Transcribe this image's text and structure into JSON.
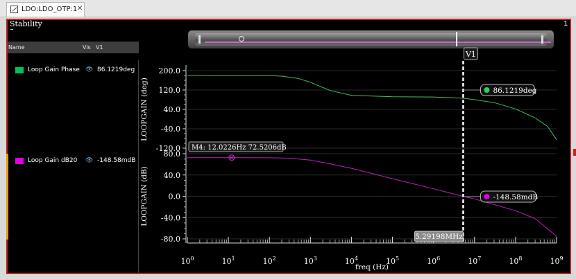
{
  "tab": {
    "label": "LDO:LDO_OTP:1",
    "close": "✕"
  },
  "panel": {
    "title": "Stability",
    "number": "1"
  },
  "legend": {
    "headers": {
      "name": "Name",
      "vis": "Vis",
      "v1": "V1"
    },
    "rows": [
      {
        "name": "Loop Gain Phase",
        "value": "86.1219deg",
        "color": "#00c060"
      },
      {
        "name": "Loop Gain dB20",
        "value": "-148.58mdB",
        "color": "#e000e0"
      }
    ]
  },
  "cursor": {
    "name": "V1",
    "label": "5.29198MHz",
    "freq_hz": 5291980
  },
  "marker": {
    "label": "M4: 12.0226Hz 72.5206dB",
    "freq_hz": 12.0226,
    "value_db": 72.5206
  },
  "chart_data": {
    "type": "line",
    "xlabel": "freq (Hz)",
    "x_scale": "log",
    "xlim": [
      1,
      1000000000
    ],
    "x_ticks": [
      {
        "base": "10",
        "exp": "0"
      },
      {
        "base": "10",
        "exp": "1"
      },
      {
        "base": "10",
        "exp": "2"
      },
      {
        "base": "10",
        "exp": "3"
      },
      {
        "base": "10",
        "exp": "4"
      },
      {
        "base": "10",
        "exp": "5"
      },
      {
        "base": "10",
        "exp": "6"
      },
      {
        "base": "10",
        "exp": "7"
      },
      {
        "base": "10",
        "exp": "8"
      },
      {
        "base": "10",
        "exp": "9"
      }
    ],
    "panels": [
      {
        "ylabel": "LOOPGAIN (deg)",
        "ylim": [
          -120,
          200
        ],
        "y_ticks": [
          "200.0",
          "120.0",
          "40.0",
          "-40.0",
          "-120.0"
        ],
        "y_tick_values": [
          200,
          120,
          40,
          -40,
          -120
        ],
        "series": [
          {
            "name": "Loop Gain Phase",
            "color": "#3fc060",
            "x": [
              1,
              100,
              200,
              500,
              1000,
              3000,
              10000,
              100000,
              1000000,
              5291980,
              10000000,
              30000000,
              100000000,
              300000000,
              600000000,
              1000000000
            ],
            "y": [
              180,
              179.8,
              177,
              168,
              152,
              118,
              98,
              92,
              91,
              86.12,
              80,
              68,
              42,
              5,
              -30,
              -85
            ],
            "cursor_value": "86.1219deg"
          }
        ]
      },
      {
        "ylabel": "LOOPGAIN (dB)",
        "ylim": [
          -80,
          80
        ],
        "y_ticks": [
          "80.0",
          "40.0",
          "0.0",
          "-40.0",
          "-80.0"
        ],
        "y_tick_values": [
          80,
          40,
          0,
          -40,
          -80
        ],
        "series": [
          {
            "name": "Loop Gain dB20",
            "color": "#c020c0",
            "x": [
              1,
              12.0226,
              100,
              300,
              1000,
              3000,
              10000,
              100000,
              1000000,
              5291980,
              10000000,
              100000000,
              300000000,
              1000000000
            ],
            "y": [
              72.5,
              72.52,
              72.3,
              71.5,
              68,
              61,
              52.5,
              33,
              14,
              -0.149,
              -5,
              -27,
              -42,
              -75
            ],
            "cursor_value": "-148.58mdB"
          }
        ]
      }
    ]
  }
}
